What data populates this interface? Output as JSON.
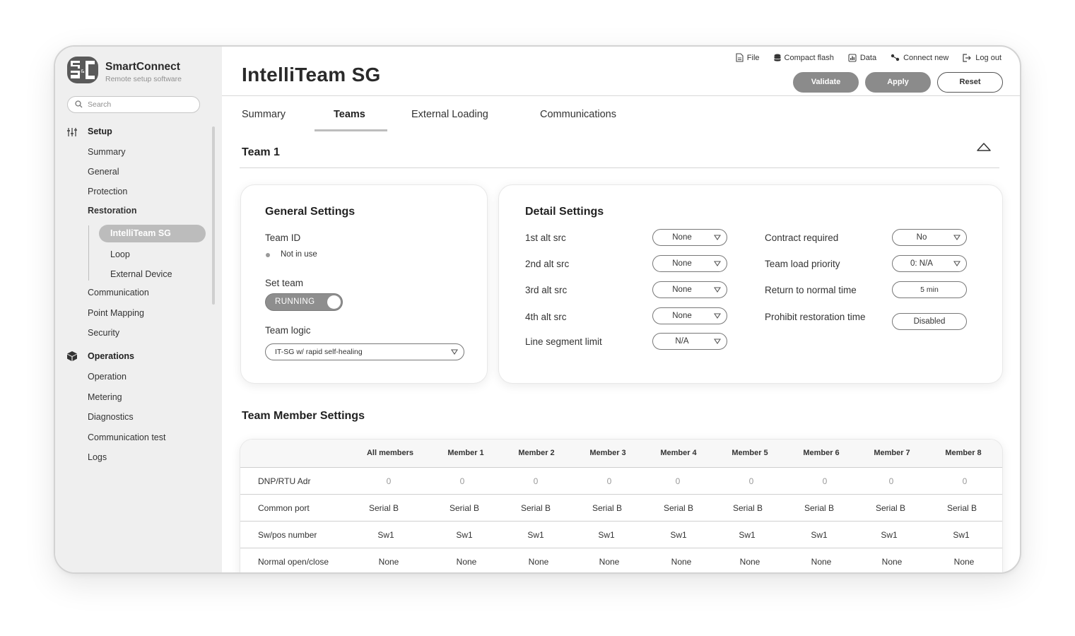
{
  "brand": {
    "name": "SmartConnect",
    "subtitle": "Remote setup software",
    "logo_text": "S&C"
  },
  "search": {
    "placeholder": "Search"
  },
  "nav": {
    "setup": {
      "label": "Setup",
      "items": [
        "Summary",
        "General",
        "Protection",
        "Restoration"
      ],
      "restoration_sub": [
        "IntelliTeam SG",
        "Loop",
        "External Device"
      ],
      "items_after": [
        "Communication",
        "Point Mapping",
        "Security"
      ]
    },
    "operations": {
      "label": "Operations",
      "items": [
        "Operation",
        "Metering",
        "Diagnostics",
        "Communication test",
        "Logs"
      ]
    }
  },
  "header": {
    "title": "IntelliTeam SG",
    "links": [
      "File",
      "Compact flash",
      "Data",
      "Connect new",
      "Log out"
    ],
    "buttons": {
      "validate": "Validate",
      "apply": "Apply",
      "reset": "Reset"
    }
  },
  "tabs": [
    "Summary",
    "Teams",
    "External Loading",
    "Communications"
  ],
  "team": {
    "title": "Team 1"
  },
  "general": {
    "title": "General Settings",
    "team_id_label": "Team ID",
    "team_id_value": "Not in use",
    "set_team_label": "Set team",
    "set_team_value": "RUNNING",
    "team_logic_label": "Team logic",
    "team_logic_value": "IT-SG w/ rapid self-healing"
  },
  "detail": {
    "title": "Detail Settings",
    "left": [
      {
        "label": "1st alt src",
        "value": "None"
      },
      {
        "label": "2nd alt src",
        "value": "None"
      },
      {
        "label": "3rd alt src",
        "value": "None"
      },
      {
        "label": "4th alt src",
        "value": "None"
      },
      {
        "label": "Line segment limit",
        "value": "N/A"
      }
    ],
    "right": [
      {
        "label": "Contract required",
        "value": "No"
      },
      {
        "label": "Team load priority",
        "value": "0: N/A"
      },
      {
        "label": "Return to normal time",
        "value": "5 min"
      },
      {
        "label": "Prohibit restoration time",
        "value": "Disabled"
      }
    ]
  },
  "members": {
    "title": "Team Member Settings",
    "columns": [
      "All members",
      "Member 1",
      "Member 2",
      "Member 3",
      "Member 4",
      "Member 5",
      "Member 6",
      "Member 7",
      "Member 8"
    ],
    "rows": [
      {
        "label": "DNP/RTU Adr",
        "values": [
          "0",
          "0",
          "0",
          "0",
          "0",
          "0",
          "0",
          "0",
          "0"
        ]
      },
      {
        "label": "Common port",
        "values": [
          "Serial B",
          "Serial B",
          "Serial B",
          "Serial B",
          "Serial B",
          "Serial B",
          "Serial B",
          "Serial B",
          "Serial B"
        ]
      },
      {
        "label": "Sw/pos number",
        "values": [
          "Sw1",
          "Sw1",
          "Sw1",
          "Sw1",
          "Sw1",
          "Sw1",
          "Sw1",
          "Sw1",
          "Sw1"
        ]
      },
      {
        "label": "Normal open/close",
        "values": [
          "None",
          "None",
          "None",
          "None",
          "None",
          "None",
          "None",
          "None",
          "None"
        ]
      }
    ]
  },
  "icons": {
    "search": "search-icon",
    "setup": "sliders-icon",
    "operations": "cube-icon",
    "file": "file-icon",
    "compact_flash": "database-icon",
    "data": "chart-icon",
    "connect_new": "connect-icon",
    "log_out": "logout-icon",
    "collapse": "chevron-up-icon",
    "dropdown": "chevron-down-icon"
  },
  "colors": {
    "sidebar_bg": "#efefef",
    "button_fill": "#8b8b8b",
    "active_pill": "#bcbcbc",
    "toggle": "#8e8e8e"
  }
}
